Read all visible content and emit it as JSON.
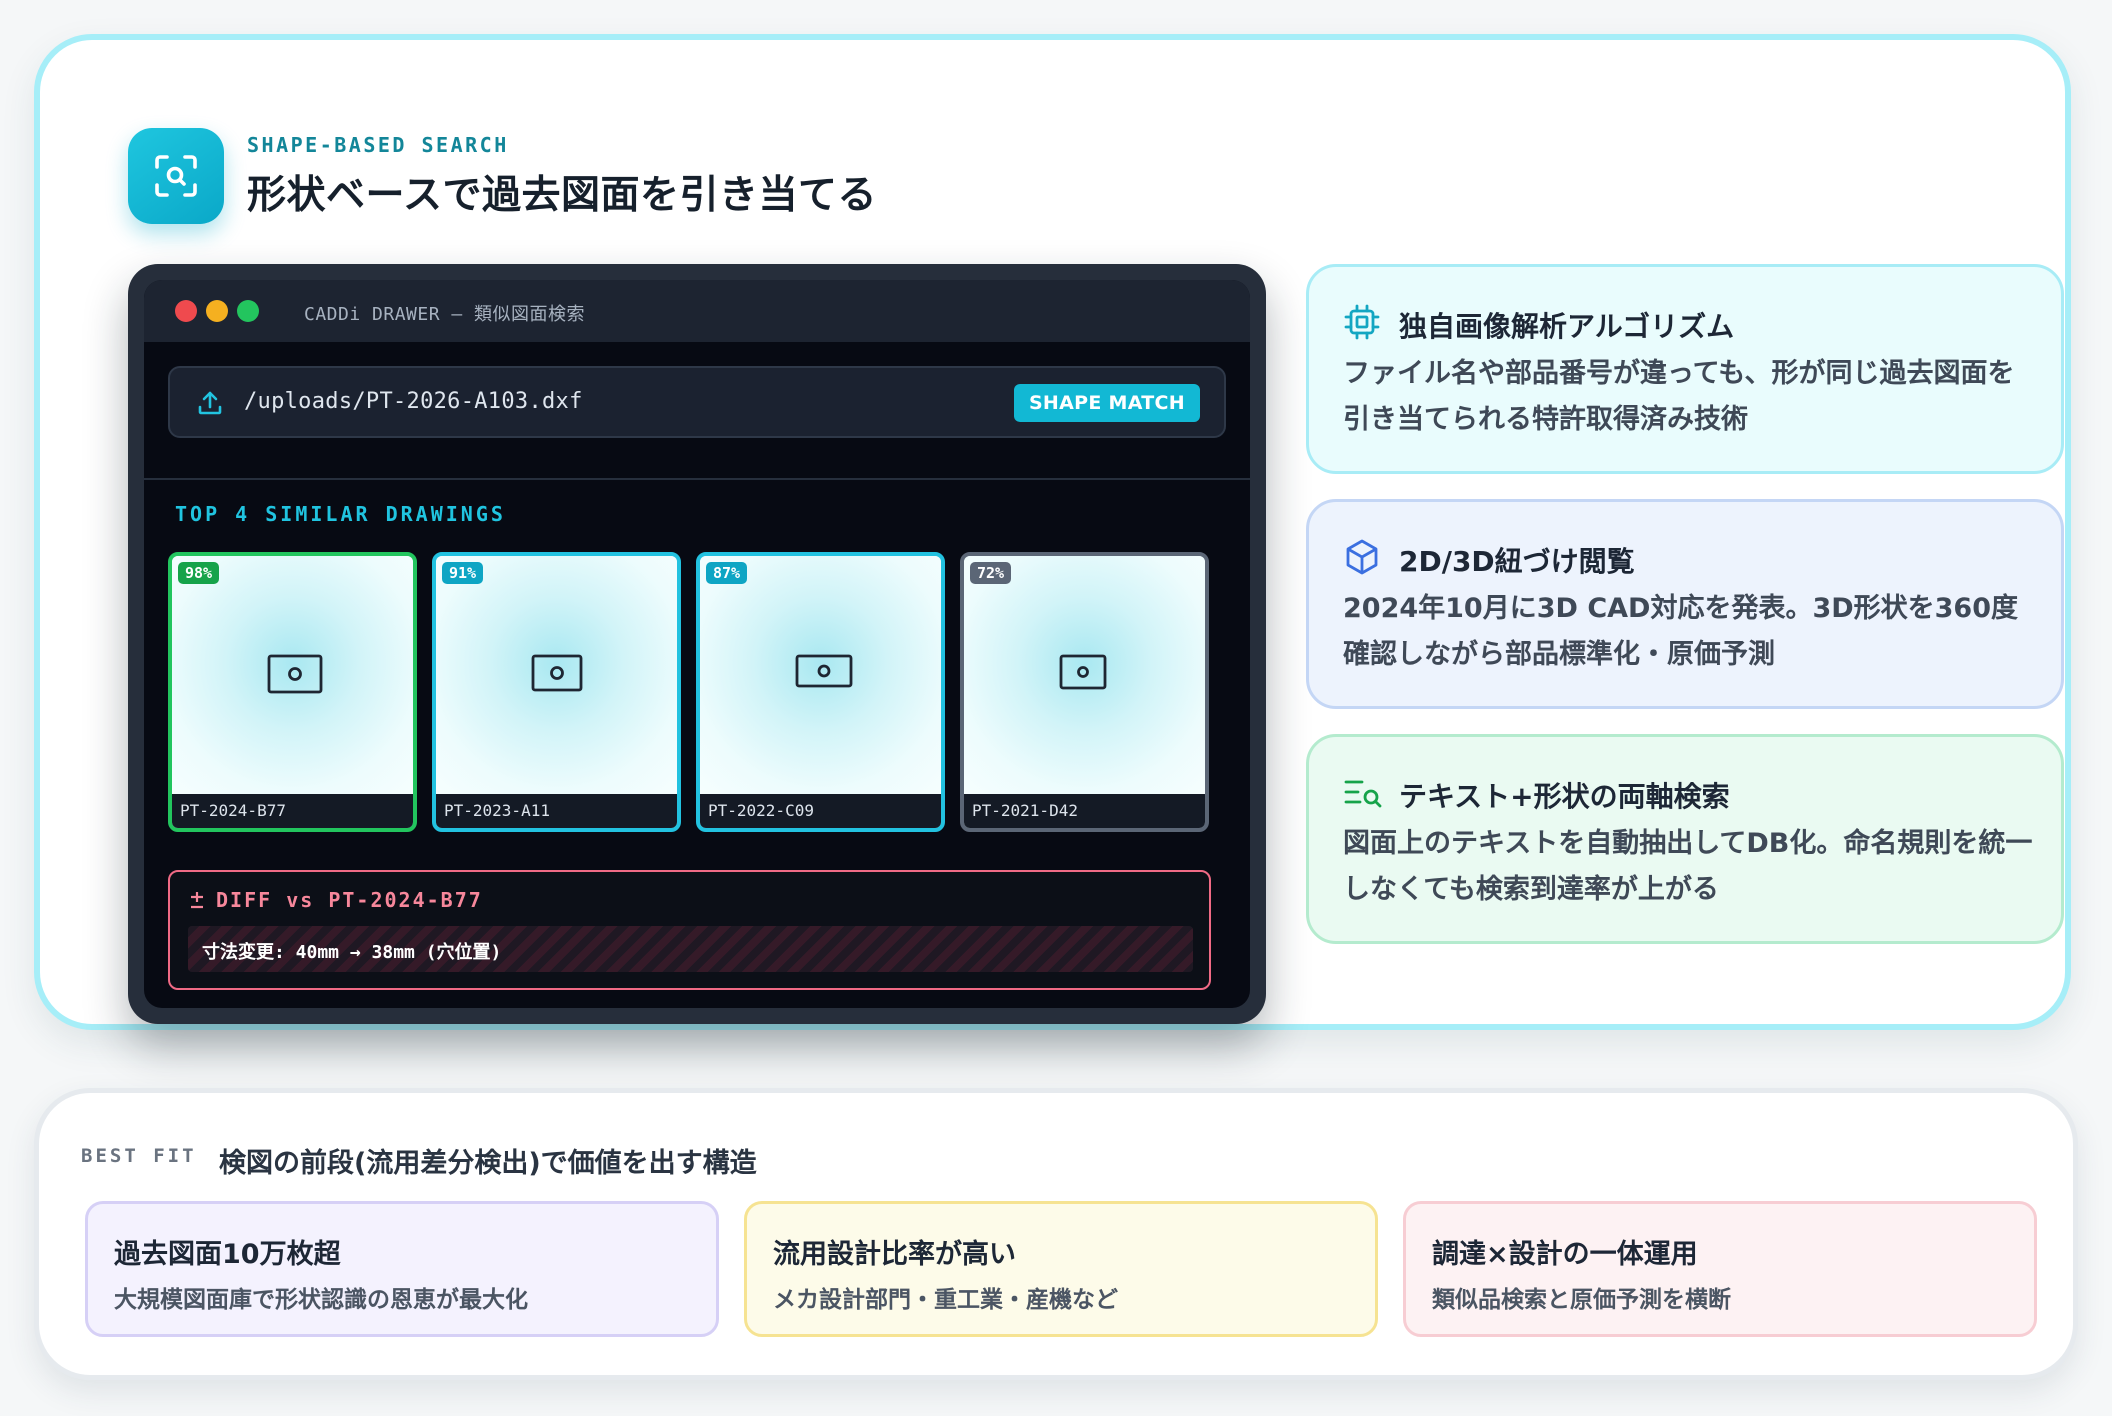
{
  "header": {
    "kicker": "SHAPE-BASED SEARCH",
    "title": "形状ベースで過去図面を引き当てる",
    "icon": "scan-search-icon"
  },
  "app": {
    "window_title": "CADDi DRAWER — 類似図面検索",
    "upload_path": "/uploads/PT-2026-A103.dxf",
    "match_button": "SHAPE MATCH",
    "results_label": "TOP 4 SIMILAR DRAWINGS",
    "results": [
      {
        "score": "98%",
        "part_id": "PT-2024-B77"
      },
      {
        "score": "91%",
        "part_id": "PT-2023-A11"
      },
      {
        "score": "87%",
        "part_id": "PT-2022-C09"
      },
      {
        "score": "72%",
        "part_id": "PT-2021-D42"
      }
    ],
    "diff": {
      "title": "DIFF vs PT-2024-B77",
      "detail": "寸法変更: 40mm → 38mm (穴位置)"
    }
  },
  "features": [
    {
      "icon": "chip-icon",
      "title": "独自画像解析アルゴリズム",
      "description": "ファイル名や部品番号が違っても、形が同じ過去図面を引き当てられる特許取得済み技術"
    },
    {
      "icon": "cube-icon",
      "title": "2D/3D紐づけ閲覧",
      "description": "2024年10月に3D CAD対応を発表。3D形状を360度確認しながら部品標準化・原価予測"
    },
    {
      "icon": "text-search-icon",
      "title": "テキスト+形状の両軸検索",
      "description": "図面上のテキストを自動抽出してDB化。命名規則を統一しなくても検索到達率が上がる"
    }
  ],
  "best_fit": {
    "kicker": "BEST FIT",
    "title": "検図の前段(流用差分検出)で価値を出す構造",
    "items": [
      {
        "title": "過去図面10万枚超",
        "description": "大規模図面庫で形状認識の恩恵が最大化"
      },
      {
        "title": "流用設計比率が高い",
        "description": "メカ設計部門・重工業・産機など"
      },
      {
        "title": "調達×設計の一体運用",
        "description": "類似品検索と原価予測を横断"
      }
    ]
  },
  "colors": {
    "accent": "#12b8d4",
    "top_match": "#22c55e",
    "diff": "#f06a85"
  }
}
